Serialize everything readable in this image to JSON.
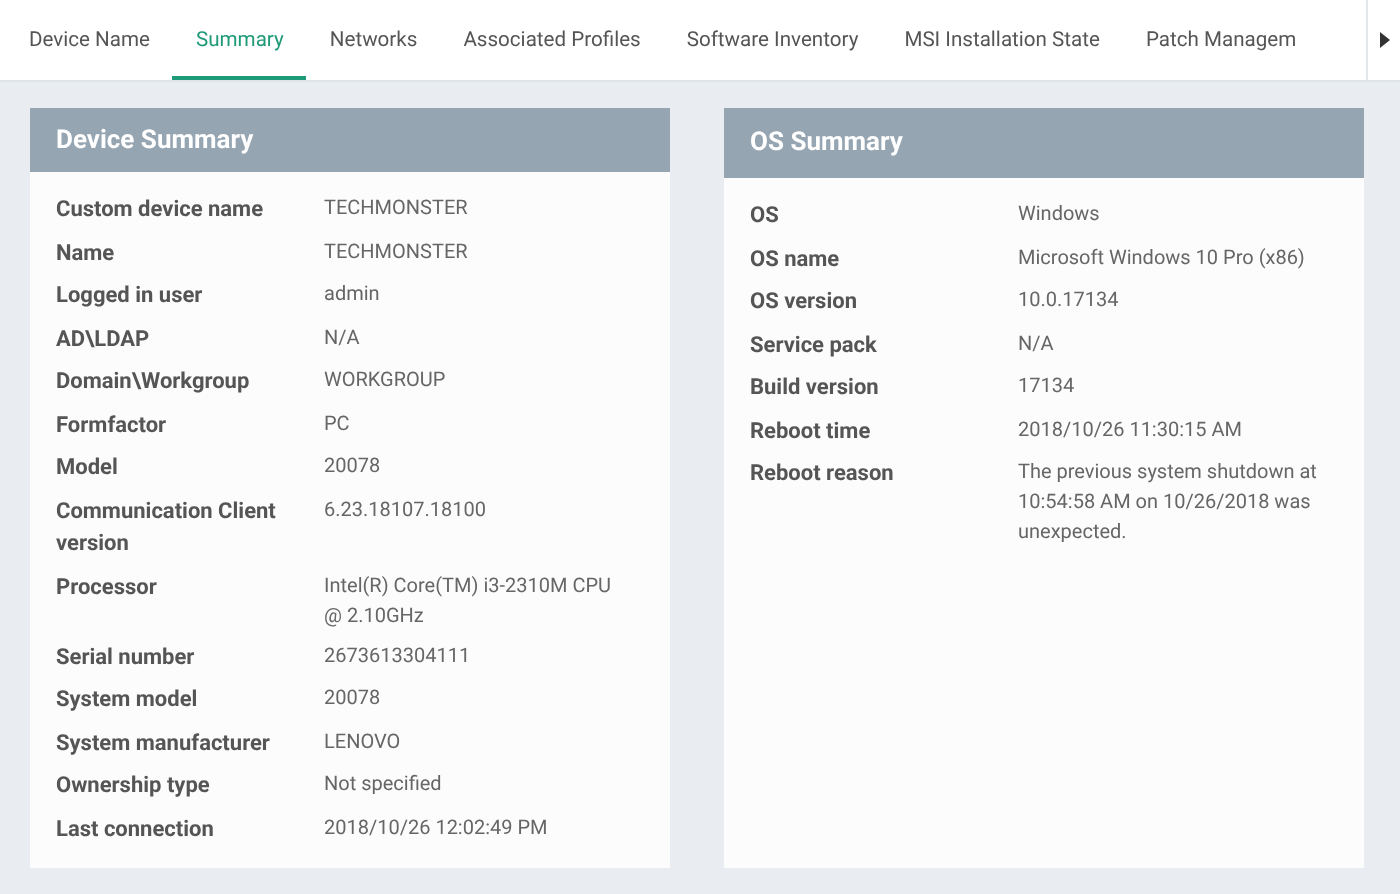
{
  "tabs": [
    {
      "label": "Device Name",
      "selected": false
    },
    {
      "label": "Summary",
      "selected": true
    },
    {
      "label": "Networks",
      "selected": false
    },
    {
      "label": "Associated Profiles",
      "selected": false
    },
    {
      "label": "Software Inventory",
      "selected": false
    },
    {
      "label": "MSI Installation State",
      "selected": false
    },
    {
      "label": "Patch Managem",
      "selected": false
    }
  ],
  "panels": [
    {
      "title": "Device Summary",
      "rows": [
        {
          "label": "Custom device name",
          "value": "TECHMONSTER"
        },
        {
          "label": "Name",
          "value": "TECHMONSTER"
        },
        {
          "label": "Logged in user",
          "value": "admin"
        },
        {
          "label": "AD\\LDAP",
          "value": "N/A"
        },
        {
          "label": "Domain\\Workgroup",
          "value": "WORKGROUP"
        },
        {
          "label": "Formfactor",
          "value": "PC"
        },
        {
          "label": "Model",
          "value": "20078"
        },
        {
          "label": "Communication Client version",
          "value": "6.23.18107.18100"
        },
        {
          "label": "Processor",
          "value": "Intel(R) Core(TM) i3-2310M CPU @ 2.10GHz"
        },
        {
          "label": "Serial number",
          "value": "2673613304111"
        },
        {
          "label": "System model",
          "value": "20078"
        },
        {
          "label": "System manufacturer",
          "value": "LENOVO"
        },
        {
          "label": "Ownership type",
          "value": "Not specified"
        },
        {
          "label": "Last connection",
          "value": "2018/10/26 12:02:49 PM"
        }
      ]
    },
    {
      "title": "OS Summary",
      "rows": [
        {
          "label": "OS",
          "value": "Windows"
        },
        {
          "label": "OS name",
          "value": "Microsoft Windows 10 Pro (x86)"
        },
        {
          "label": "OS version",
          "value": "10.0.17134"
        },
        {
          "label": "Service pack",
          "value": "N/A"
        },
        {
          "label": "Build version",
          "value": "17134"
        },
        {
          "label": "Reboot time",
          "value": "2018/10/26 11:30:15 AM"
        },
        {
          "label": "Reboot reason",
          "value": "The previous system shutdown at 10:54:58 AM on 10/26/2018 was unexpected."
        }
      ]
    }
  ]
}
